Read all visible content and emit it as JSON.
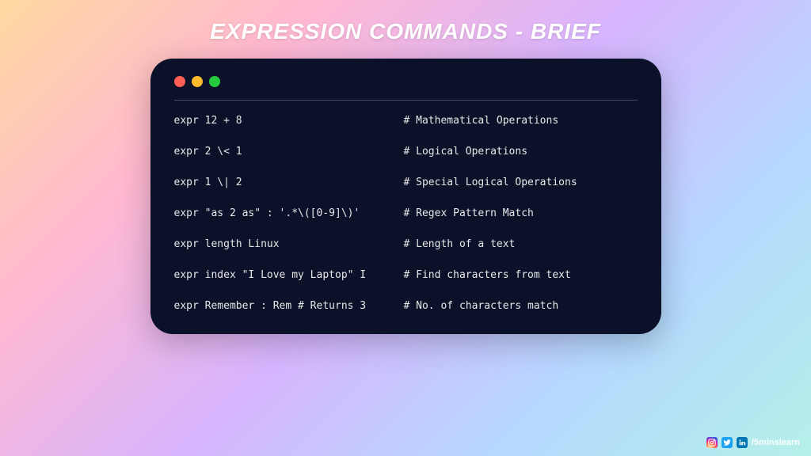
{
  "title": "EXPRESSION COMMANDS - BRIEF",
  "lines": [
    {
      "command": "expr 12 + 8",
      "comment": "# Mathematical Operations"
    },
    {
      "command": "expr 2 \\< 1",
      "comment": "# Logical Operations"
    },
    {
      "command": "expr 1 \\| 2",
      "comment": "# Special Logical Operations"
    },
    {
      "command": "expr \"as 2 as\" : '.*\\([0-9]\\)'",
      "comment": "# Regex Pattern Match"
    },
    {
      "command": "expr length Linux",
      "comment": "# Length of a text"
    },
    {
      "command": "expr index \"I Love my Laptop\" I",
      "comment": "# Find characters from text"
    },
    {
      "command": "expr Remember : Rem # Returns 3",
      "comment": "# No. of characters match"
    }
  ],
  "footer": {
    "handle": "/5minslearn"
  }
}
